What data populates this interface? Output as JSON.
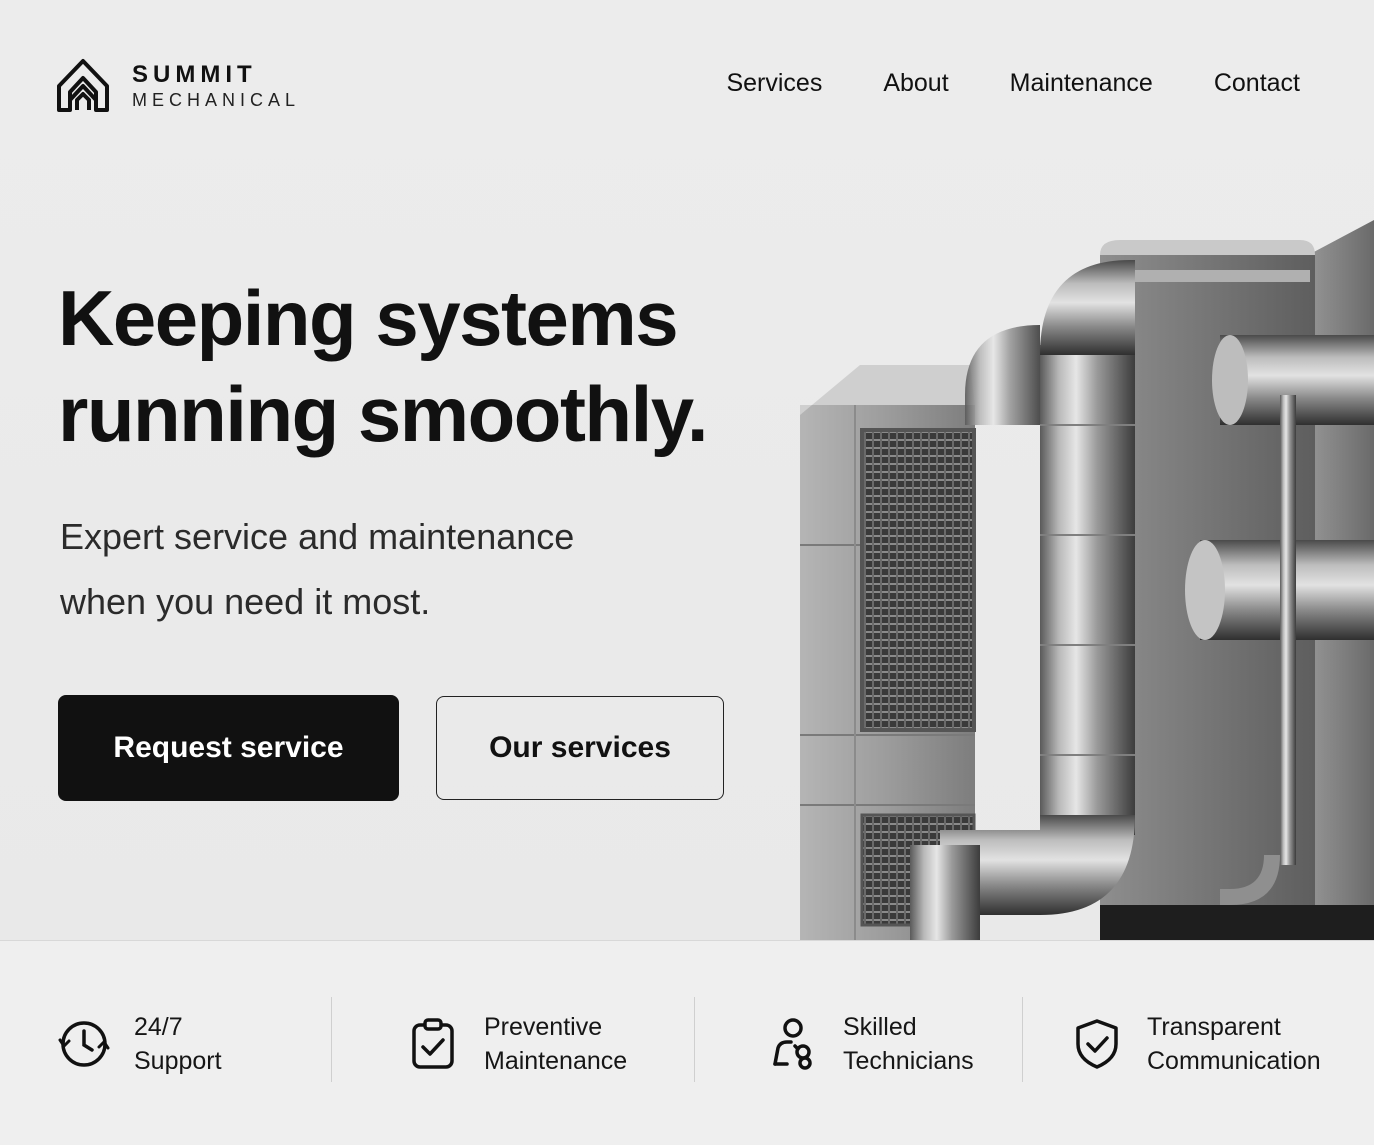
{
  "brand": {
    "name": "SUMMIT",
    "tagline": "MECHANICAL"
  },
  "nav": {
    "items": [
      {
        "label": "Services"
      },
      {
        "label": "About"
      },
      {
        "label": "Maintenance"
      },
      {
        "label": "Contact"
      }
    ]
  },
  "hero": {
    "headline_line1": "Keeping systems",
    "headline_line2": "running smoothly.",
    "subhead_line1": "Expert service and maintenance",
    "subhead_line2": "when you need it most.",
    "primary_cta": "Request service",
    "secondary_cta": "Our services",
    "image_subject": "industrial HVAC unit with steel ductwork"
  },
  "features": [
    {
      "icon": "clock-icon",
      "line1": "24/7",
      "line2": "Support"
    },
    {
      "icon": "clipboard-check-icon",
      "line1": "Preventive",
      "line2": "Maintenance"
    },
    {
      "icon": "technicians-icon",
      "line1": "Skilled",
      "line2": "Technicians"
    },
    {
      "icon": "shield-check-icon",
      "line1": "Transparent",
      "line2": "Communication"
    }
  ],
  "colors": {
    "background": "#ebebeb",
    "text": "#111111",
    "primary_button": "#111111",
    "primary_button_text": "#ffffff"
  }
}
